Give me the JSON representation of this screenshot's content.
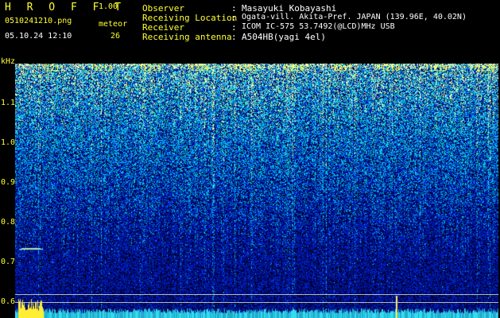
{
  "app": {
    "name": "H R O F F T",
    "version": "1.00",
    "filename": "0510241210.png",
    "datetime": "05.10.24 12:10",
    "meteor_label": "meteor",
    "meteor_count": "26"
  },
  "info": {
    "rows": [
      {
        "label": "Observer",
        "sep": ":",
        "value": "Masayuki Kobayashi"
      },
      {
        "label": "Receiving Location",
        "sep": ":",
        "value": "Ogata-vill. Akita-Pref. JAPAN (139.96E, 40.02N)"
      },
      {
        "label": "Receiver",
        "sep": ":",
        "value": "ICOM IC-575 53.7492(@LCD)MHz USB"
      },
      {
        "label": "Receiving antenna",
        "sep": ":",
        "value": "A504HB(yagi 4el)"
      }
    ]
  },
  "axis": {
    "unit": "kHz",
    "freq_labels": [
      "1.1",
      "1.0",
      "0.9",
      "0.8",
      "0.7",
      "0.6"
    ],
    "time_labels": [
      "1211",
      "1212",
      "1213",
      "1214",
      "1215",
      "1216",
      "1217",
      "1218",
      "1219",
      "1220"
    ]
  },
  "colors": {
    "label": "#ffff33",
    "text": "#ffffff",
    "background": "#000000"
  }
}
